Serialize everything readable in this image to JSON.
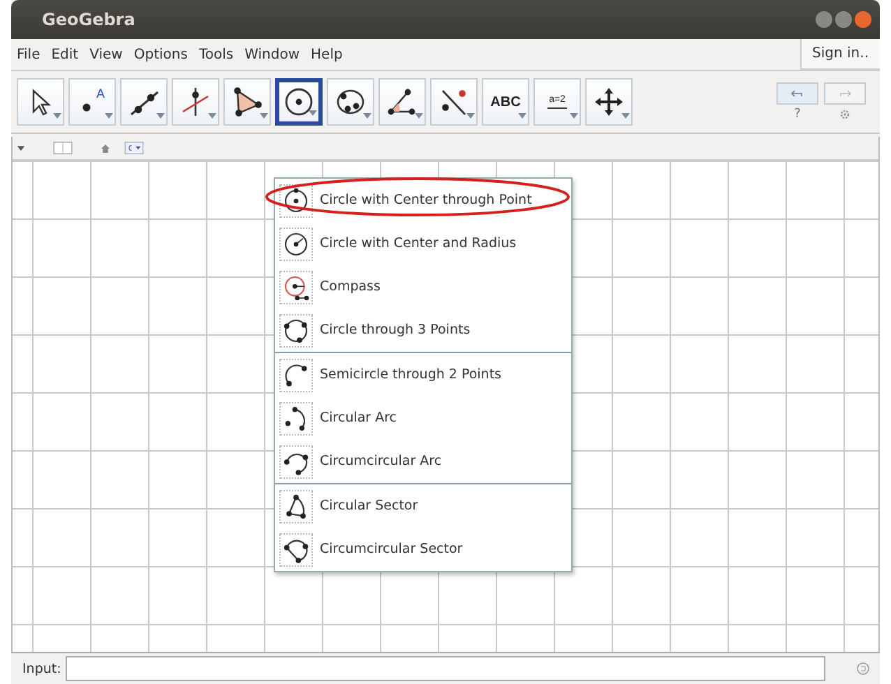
{
  "window": {
    "title": "GeoGebra"
  },
  "menu_bar": {
    "items": [
      "File",
      "Edit",
      "View",
      "Options",
      "Tools",
      "Window",
      "Help"
    ],
    "sign_in": "Sign in.."
  },
  "toolbar": {
    "tools": [
      {
        "kind": "move",
        "selected": false
      },
      {
        "kind": "point",
        "label": "A",
        "selected": false
      },
      {
        "kind": "line",
        "selected": false
      },
      {
        "kind": "perpendicular",
        "selected": false
      },
      {
        "kind": "polygon",
        "selected": false
      },
      {
        "kind": "circle",
        "selected": true
      },
      {
        "kind": "conic",
        "selected": false
      },
      {
        "kind": "angle",
        "selected": false
      },
      {
        "kind": "reflect",
        "selected": false
      },
      {
        "kind": "text",
        "label": "ABC",
        "selected": false
      },
      {
        "kind": "slider",
        "label": "a=2",
        "selected": false
      },
      {
        "kind": "move-view",
        "selected": false
      }
    ],
    "help": "?"
  },
  "tool_menu": {
    "groups": [
      [
        {
          "kind": "center-point",
          "label": "Circle with Center through Point",
          "highlighted": true
        },
        {
          "kind": "center-radius",
          "label": "Circle with Center and Radius",
          "highlighted": false
        },
        {
          "kind": "compass",
          "label": "Compass",
          "highlighted": false
        },
        {
          "kind": "three-points",
          "label": "Circle through 3 Points",
          "highlighted": false
        }
      ],
      [
        {
          "kind": "semicircle",
          "label": "Semicircle through 2 Points",
          "highlighted": false
        },
        {
          "kind": "arc",
          "label": "Circular Arc",
          "highlighted": false
        },
        {
          "kind": "circum-arc",
          "label": "Circumcircular Arc",
          "highlighted": false
        }
      ],
      [
        {
          "kind": "sector",
          "label": "Circular Sector",
          "highlighted": false
        },
        {
          "kind": "circum-sector",
          "label": "Circumcircular Sector",
          "highlighted": false
        }
      ]
    ]
  },
  "input_bar": {
    "label": "Input:"
  }
}
